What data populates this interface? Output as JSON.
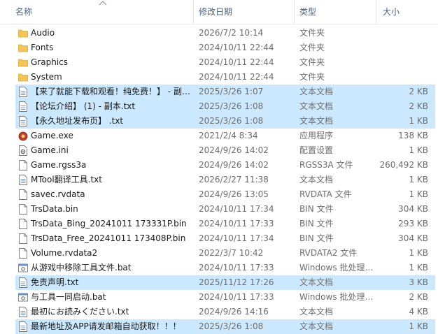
{
  "header": {
    "name": "名称",
    "date": "修改日期",
    "type": "类型",
    "size": "大小"
  },
  "colors": {
    "selection": "#cce8ff",
    "selection_border": "#99d1ff",
    "folder": "#f2c55c",
    "header_text": "#4c607a"
  },
  "files": [
    {
      "name": "Audio",
      "date": "2026/7/2 10:14",
      "type": "文件夹",
      "size": "",
      "icon": "folder-icon",
      "selected": false
    },
    {
      "name": "Fonts",
      "date": "2024/10/11 22:44",
      "type": "文件夹",
      "size": "",
      "icon": "folder-icon",
      "selected": false
    },
    {
      "name": "Graphics",
      "date": "2024/10/11 22:44",
      "type": "文件夹",
      "size": "",
      "icon": "folder-icon",
      "selected": false
    },
    {
      "name": "System",
      "date": "2024/10/11 22:44",
      "type": "文件夹",
      "size": "",
      "icon": "folder-icon",
      "selected": false
    },
    {
      "name": "【来了就能下载和观看！纯免费！】 - 副…",
      "date": "2025/3/26 1:07",
      "type": "文本文档",
      "size": "2 KB",
      "icon": "text-file-icon",
      "selected": true
    },
    {
      "name": "【论坛介绍】 (1) - 副本.txt",
      "date": "2025/3/26 1:08",
      "type": "文本文档",
      "size": "2 KB",
      "icon": "text-file-icon",
      "selected": true
    },
    {
      "name": "【永久地址发布页】 .txt",
      "date": "2025/3/26 1:08",
      "type": "文本文档",
      "size": "1 KB",
      "icon": "text-file-icon",
      "selected": true
    },
    {
      "name": "Game.exe",
      "date": "2021/2/4 8:34",
      "type": "应用程序",
      "size": "138 KB",
      "icon": "app-icon",
      "selected": false
    },
    {
      "name": "Game.ini",
      "date": "2024/9/26 14:02",
      "type": "配置设置",
      "size": "1 KB",
      "icon": "settings-file-icon",
      "selected": false
    },
    {
      "name": "Game.rgss3a",
      "date": "2024/9/26 14:02",
      "type": "RGSS3A 文件",
      "size": "260,492 KB",
      "icon": "file-icon",
      "selected": false
    },
    {
      "name": "MTool翻译工具.txt",
      "date": "2026/2/27 11:38",
      "type": "文本文档",
      "size": "1 KB",
      "icon": "text-file-icon",
      "selected": false
    },
    {
      "name": "savec.rvdata",
      "date": "2024/9/26 13:05",
      "type": "RVDATA 文件",
      "size": "1 KB",
      "icon": "file-icon",
      "selected": false
    },
    {
      "name": "TrsData.bin",
      "date": "2024/10/11 17:34",
      "type": "BIN 文件",
      "size": "304 KB",
      "icon": "file-icon",
      "selected": false
    },
    {
      "name": "TrsData_Bing_20241011 173331P.bin",
      "date": "2024/10/11 17:33",
      "type": "BIN 文件",
      "size": "293 KB",
      "icon": "file-icon",
      "selected": false
    },
    {
      "name": "TrsData_Free_20241011 173408P.bin",
      "date": "2024/10/11 17:34",
      "type": "BIN 文件",
      "size": "304 KB",
      "icon": "file-icon",
      "selected": false
    },
    {
      "name": "Volume.rvdata2",
      "date": "2022/3/7 10:42",
      "type": "RVDATA2 文件",
      "size": "1 KB",
      "icon": "file-icon",
      "selected": false
    },
    {
      "name": "从游戏中移除工具文件.bat",
      "date": "2024/10/11 17:33",
      "type": "Windows 批处理…",
      "size": "1 KB",
      "icon": "batch-file-icon",
      "selected": false
    },
    {
      "name": "免责声明.txt",
      "date": "2025/11/12 17:26",
      "type": "文本文档",
      "size": "3 KB",
      "icon": "text-file-icon",
      "selected": true
    },
    {
      "name": "与工具一同启动.bat",
      "date": "2024/10/11 17:33",
      "type": "Windows 批处理…",
      "size": "2 KB",
      "icon": "batch-file-icon",
      "selected": false
    },
    {
      "name": "最初にお読みください.txt",
      "date": "2024/9/26 14:16",
      "type": "文本文档",
      "size": "4 KB",
      "icon": "text-file-icon",
      "selected": false
    },
    {
      "name": "最新地址及APP请发邮箱自动获取！！！",
      "date": "2025/3/26 1:08",
      "type": "文本文档",
      "size": "1 KB",
      "icon": "text-file-icon",
      "selected": true
    }
  ]
}
